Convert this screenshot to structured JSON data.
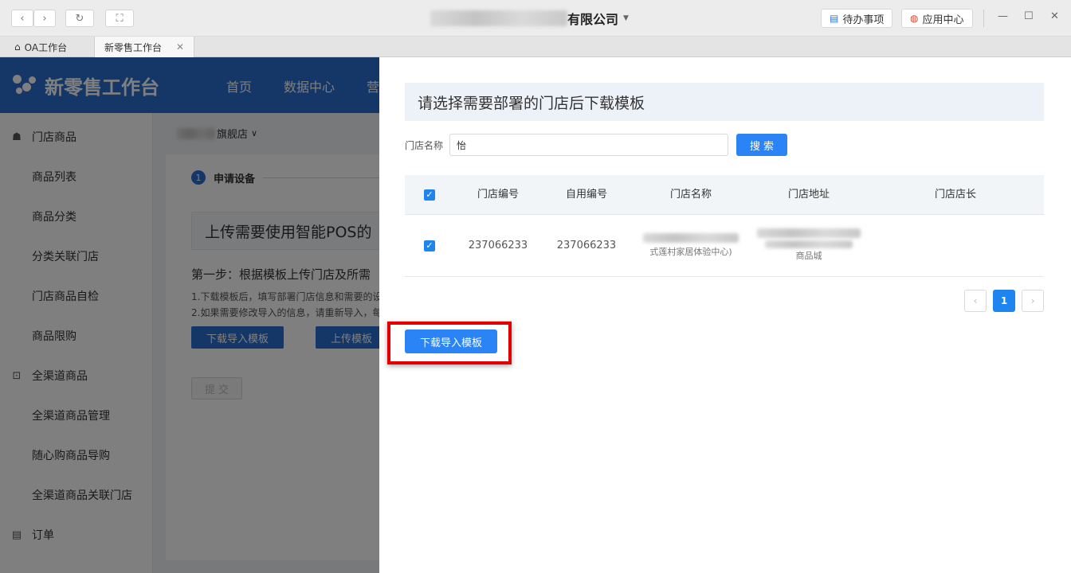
{
  "titlebar": {
    "company_suffix": "有限公司",
    "todo_label": "待办事项",
    "app_center_label": "应用中心",
    "nav_back_icon": "‹",
    "nav_forward_icon": "›",
    "refresh_icon": "↻",
    "fullscreen_icon": "⛶",
    "min_icon": "—",
    "max_icon": "☐",
    "close_icon": "✕"
  },
  "tabs": [
    {
      "label": "OA工作台"
    },
    {
      "label": "新零售工作台"
    }
  ],
  "app": {
    "logo_text": "新零售工作台",
    "nav": [
      "首页",
      "数据中心",
      "营"
    ],
    "sidebar": {
      "groups": [
        {
          "label": "门店商品",
          "items": [
            "商品列表",
            "商品分类",
            "分类关联门店",
            "门店商品自检",
            "商品限购"
          ]
        },
        {
          "label": "全渠道商品",
          "items": [
            "全渠道商品管理",
            "随心购商品导购",
            "全渠道商品关联门店"
          ]
        },
        {
          "label": "订单",
          "items": []
        }
      ]
    },
    "store_selector": "旗舰店",
    "step": {
      "number": "1",
      "label": "申请设备"
    },
    "upload_title": "上传需要使用智能POS的",
    "step1_text": "第一步：根据模板上传门店及所需",
    "tips": [
      "1.下载模板后，填写部署门店信息和需要的设",
      "2.如果需要修改导入的信息，请重新导入，每"
    ],
    "download_btn": "下载导入模板",
    "upload_btn": "上传模板",
    "submit_btn": "提 交"
  },
  "drawer": {
    "title": "请选择需要部署的门店后下载模板",
    "search_label": "门店名称",
    "search_value": "怡",
    "search_btn": "搜 索",
    "columns": [
      "门店编号",
      "自用编号",
      "门店名称",
      "门店地址",
      "门店店长"
    ],
    "rows": [
      {
        "store_no": "237066233",
        "self_no": "237066233",
        "name_visible": "式莲村家居体验中心)",
        "address_visible": "商品城",
        "manager": ""
      }
    ],
    "pagination": {
      "current": "1",
      "prev": "‹",
      "next": "›"
    },
    "download_btn": "下载导入模板"
  }
}
